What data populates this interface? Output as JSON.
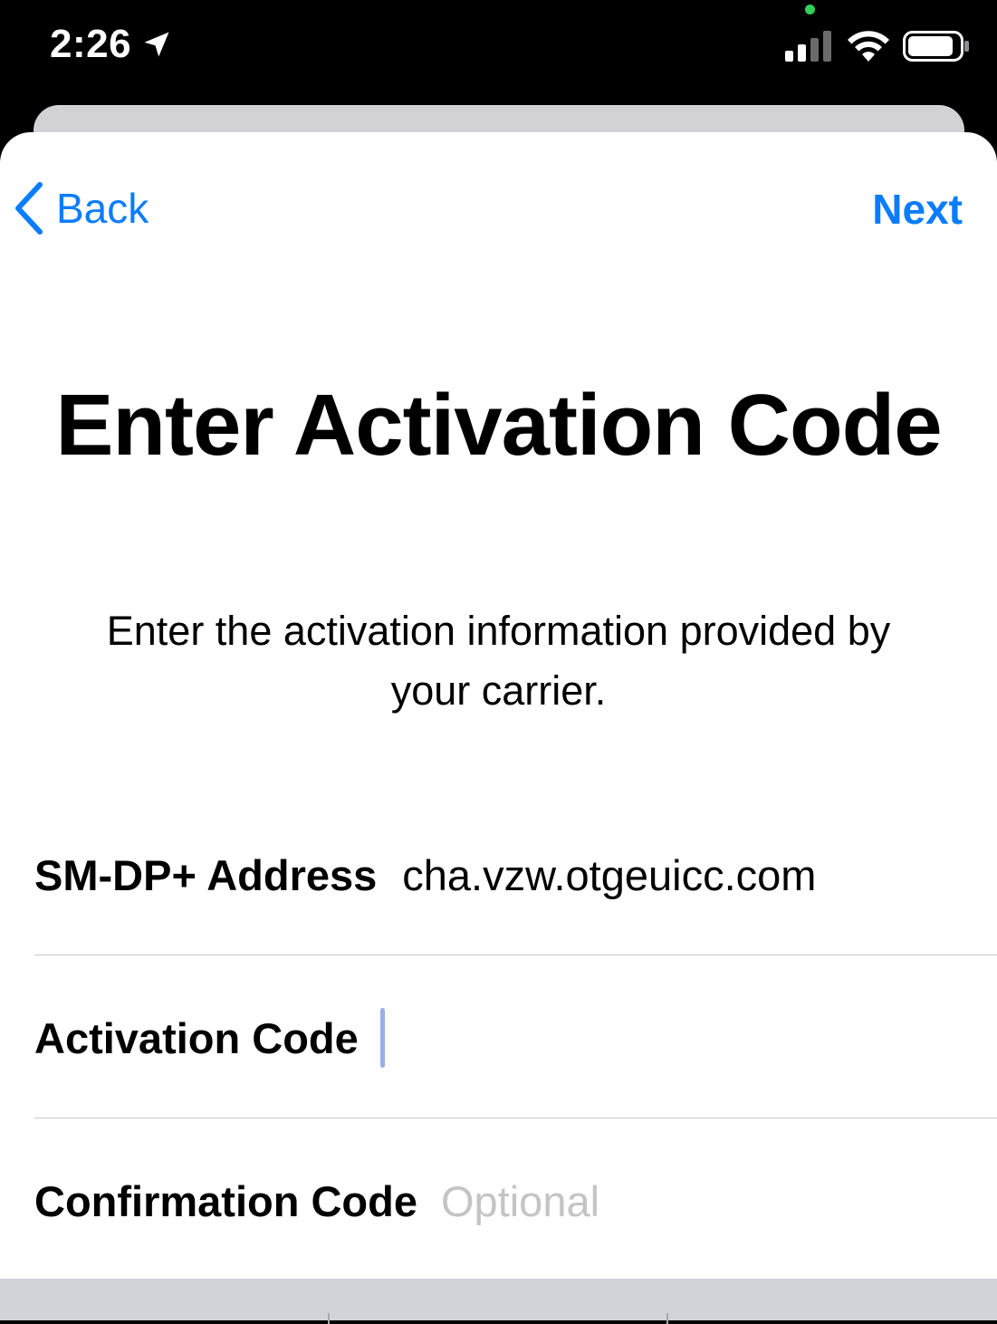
{
  "status_bar": {
    "time": "2:26",
    "location_icon": "location-arrow-icon",
    "signal_icon": "cellular-signal-icon",
    "wifi_icon": "wifi-icon",
    "battery_icon": "battery-icon",
    "indicator_color": "#30d158"
  },
  "nav": {
    "back_label": "Back",
    "next_label": "Next",
    "accent_color": "#0a7cff"
  },
  "header": {
    "title": "Enter Activation Code",
    "subtitle": "Enter the activation information provided by your carrier."
  },
  "form": {
    "smdp": {
      "label": "SM-DP+ Address",
      "value": "cha.vzw.otgeuicc.com"
    },
    "activation_code": {
      "label": "Activation Code",
      "value": ""
    },
    "confirmation_code": {
      "label": "Confirmation Code",
      "placeholder": "Optional",
      "value": ""
    }
  }
}
